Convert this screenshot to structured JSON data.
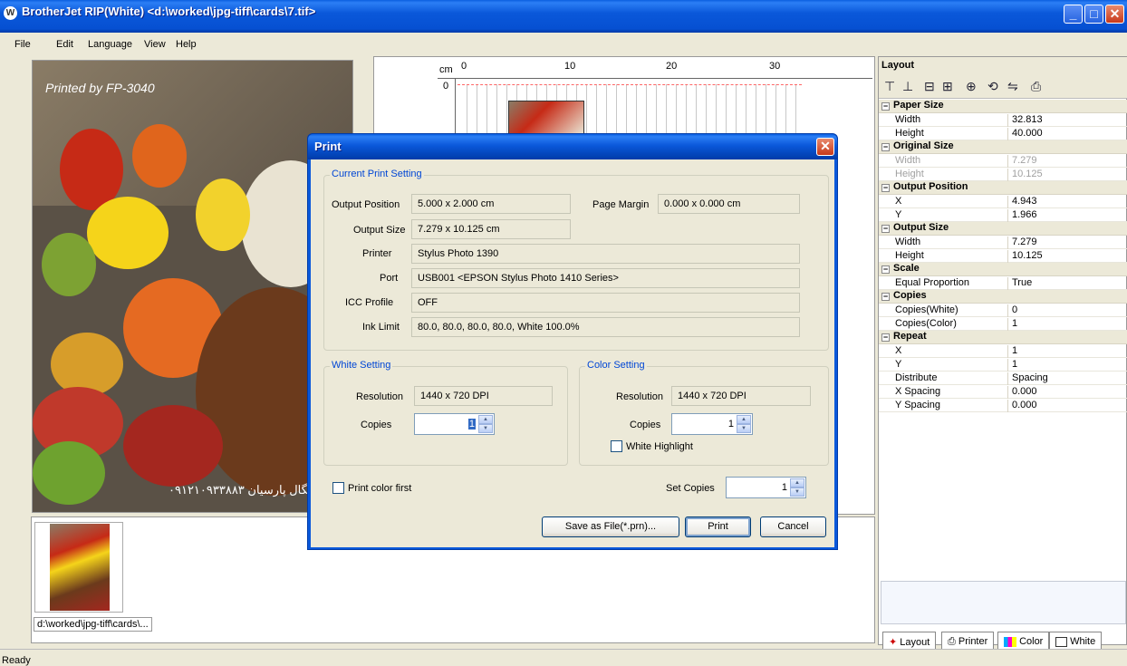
{
  "window": {
    "icon_letter": "W",
    "title": "BrotherJet RIP(White) <d:\\worked\\jpg-tiff\\cards\\7.tif>",
    "min": "_",
    "max": "□",
    "close": "✕"
  },
  "menu": [
    "File",
    "Edit",
    "Language",
    "View",
    "Help"
  ],
  "preview": {
    "printed_by": "Printed by FP-3040",
    "phone_text": "۰۹۱۲۱۰۹۳۳۸۸۳ سگال پارسیان"
  },
  "ruler": {
    "unit": "cm",
    "ticks": [
      "0",
      "10",
      "20",
      "30"
    ],
    "vertical_tick": "0"
  },
  "thumbnail": {
    "caption": "d:\\worked\\jpg-tiff\\cards\\..."
  },
  "layout_panel": {
    "title": "Layout",
    "sections": [
      {
        "name": "Paper Size",
        "rows": [
          [
            "Width",
            "32.813",
            false
          ],
          [
            "Height",
            "40.000",
            false
          ]
        ]
      },
      {
        "name": "Original Size",
        "rows": [
          [
            "Width",
            "7.279",
            true
          ],
          [
            "Height",
            "10.125",
            true
          ]
        ]
      },
      {
        "name": "Output Position",
        "rows": [
          [
            "X",
            "4.943",
            false
          ],
          [
            "Y",
            "1.966",
            false
          ]
        ]
      },
      {
        "name": "Output Size",
        "rows": [
          [
            "Width",
            "7.279",
            false
          ],
          [
            "Height",
            "10.125",
            false
          ]
        ]
      },
      {
        "name": "Scale",
        "rows": [
          [
            "Equal Proportion",
            "True",
            false
          ]
        ]
      },
      {
        "name": "Copies",
        "rows": [
          [
            "Copies(White)",
            "0",
            false
          ],
          [
            "Copies(Color)",
            "1",
            false
          ]
        ]
      },
      {
        "name": "Repeat",
        "rows": [
          [
            "X",
            "1",
            false
          ],
          [
            "Y",
            "1",
            false
          ],
          [
            "Distribute",
            "Spacing",
            false
          ],
          [
            "X Spacing",
            "0.000",
            false
          ],
          [
            "Y Spacing",
            "0.000",
            false
          ]
        ]
      }
    ],
    "tabs": [
      "Layout",
      "Printer",
      "Color",
      "White"
    ]
  },
  "status": {
    "text": "Ready"
  },
  "dialog": {
    "title": "Print",
    "current": {
      "group": "Current Print Setting",
      "output_position_label": "Output Position",
      "output_position": "5.000 x 2.000 cm",
      "page_margin_label": "Page Margin",
      "page_margin": "0.000 x 0.000 cm",
      "output_size_label": "Output Size",
      "output_size": "7.279 x 10.125 cm",
      "printer_label": "Printer",
      "printer": "Stylus Photo 1390",
      "port_label": "Port",
      "port": "USB001  <EPSON Stylus Photo 1410 Series>",
      "icc_label": "ICC Profile",
      "icc": "OFF",
      "ink_label": "Ink Limit",
      "ink": "80.0, 80.0, 80.0, 80.0, White 100.0%"
    },
    "white": {
      "group": "White Setting",
      "resolution_label": "Resolution",
      "resolution": "1440 x 720 DPI",
      "copies_label": "Copies",
      "copies": "1"
    },
    "color": {
      "group": "Color Setting",
      "resolution_label": "Resolution",
      "resolution": "1440 x 720 DPI",
      "copies_label": "Copies",
      "copies": "1",
      "white_highlight": "White Highlight"
    },
    "print_color_first": "Print color first",
    "set_copies_label": "Set Copies",
    "set_copies": "1",
    "save_button": "Save as File(*.prn)...",
    "print_button": "Print",
    "cancel_button": "Cancel"
  }
}
